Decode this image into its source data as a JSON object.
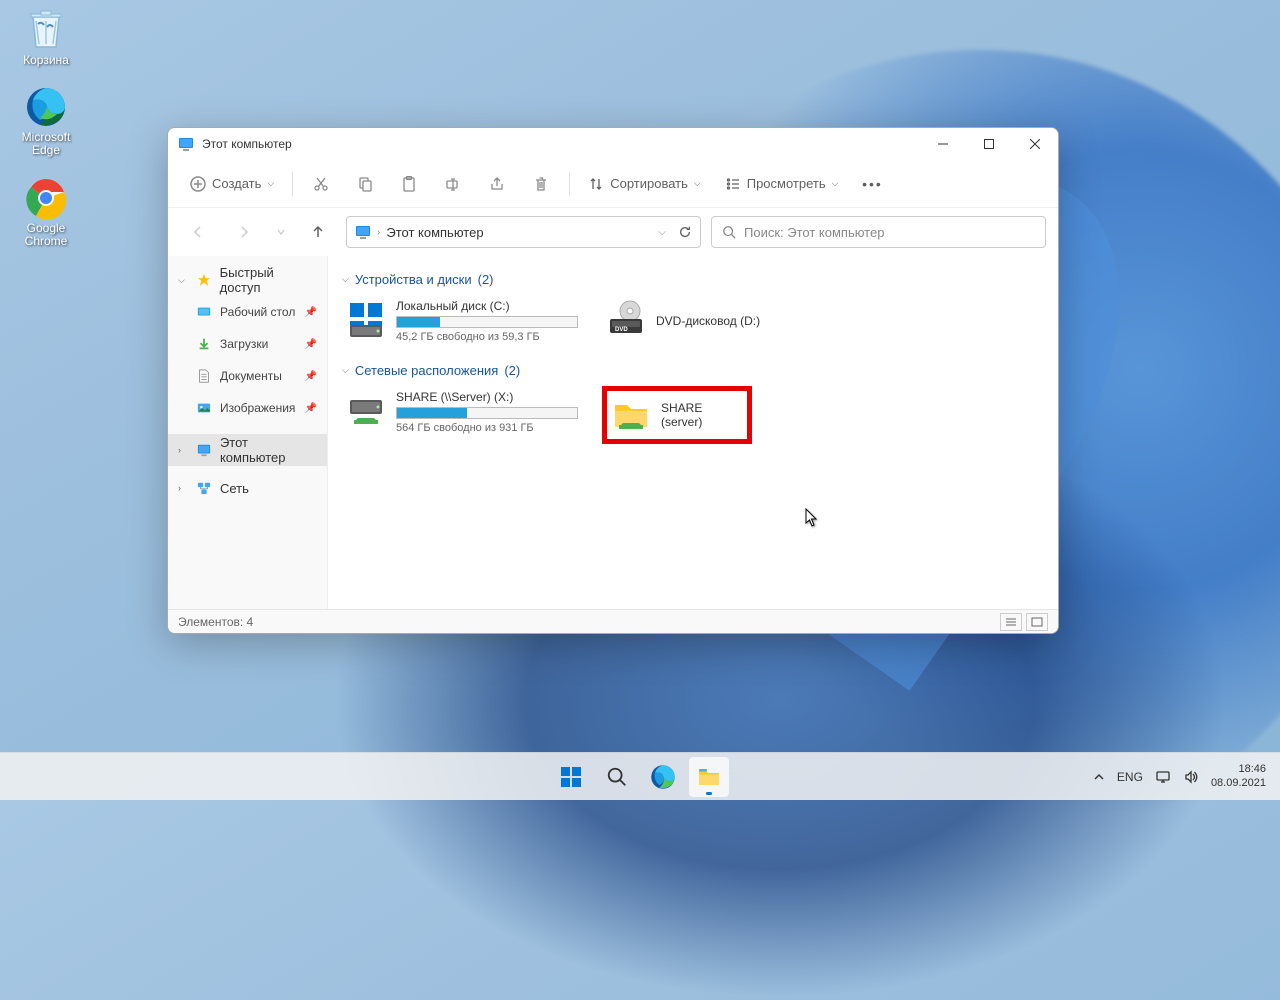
{
  "desktop": {
    "icons": [
      {
        "name": "recycle-bin-icon",
        "label": "Корзина"
      },
      {
        "name": "edge-icon",
        "label": "Microsoft Edge"
      },
      {
        "name": "chrome-icon",
        "label": "Google Chrome"
      }
    ]
  },
  "explorer": {
    "title": "Этот компьютер",
    "toolbar": {
      "new_label": "Создать",
      "sort_label": "Сортировать",
      "view_label": "Просмотреть"
    },
    "address": {
      "location": "Этот компьютер"
    },
    "search": {
      "placeholder": "Поиск: Этот компьютер"
    },
    "sidebar": {
      "quick_access": "Быстрый доступ",
      "desktop": "Рабочий стол",
      "downloads": "Загрузки",
      "documents": "Документы",
      "pictures": "Изображения",
      "this_pc": "Этот компьютер",
      "network": "Сеть"
    },
    "groups": [
      {
        "title": "Устройства и диски",
        "count": "(2)",
        "items": [
          {
            "name": "Локальный диск (C:)",
            "free_text": "45,2 ГБ свободно из 59,3 ГБ",
            "fill_pct": 24,
            "type": "hdd"
          },
          {
            "name": "DVD-дисковод (D:)",
            "type": "dvd"
          }
        ]
      },
      {
        "title": "Сетевые расположения",
        "count": "(2)",
        "items": [
          {
            "name": "SHARE (\\\\Server) (X:)",
            "free_text": "564 ГБ свободно из 931 ГБ",
            "fill_pct": 39,
            "type": "netdrive"
          },
          {
            "name": "SHARE (server)",
            "type": "netfolder",
            "highlighted": true
          }
        ]
      }
    ],
    "statusbar": {
      "items_label": "Элементов: 4"
    }
  },
  "taskbar": {
    "lang": "ENG",
    "time": "18:46",
    "date": "08.09.2021"
  }
}
